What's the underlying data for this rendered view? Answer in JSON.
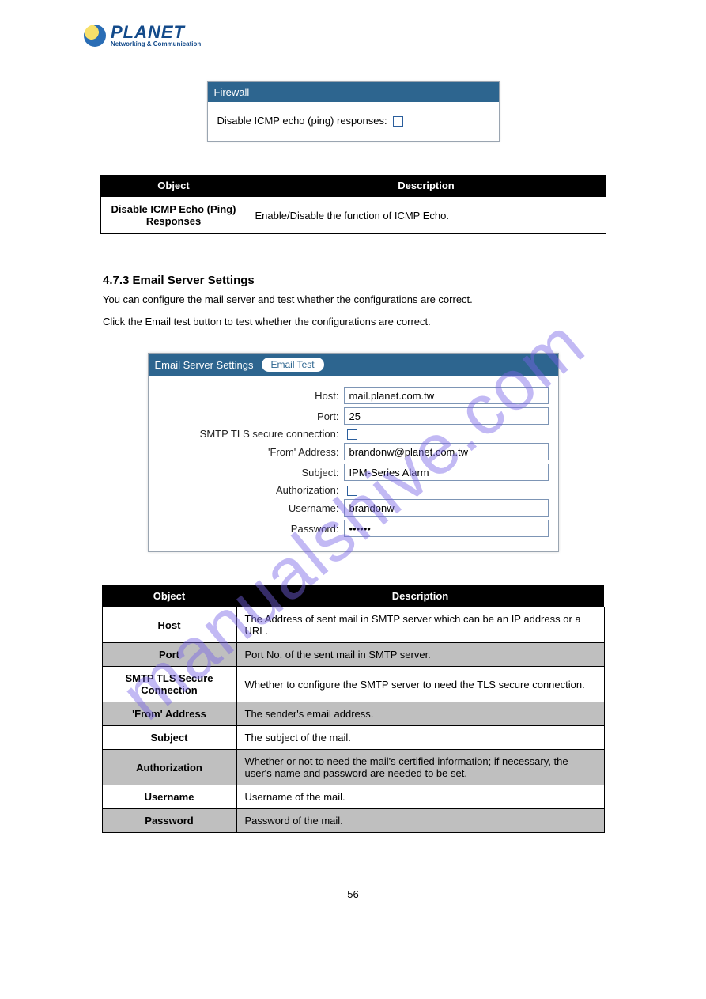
{
  "logo": {
    "brand": "PLANET",
    "tagline": "Networking & Communication"
  },
  "firewall_panel": {
    "title": "Firewall",
    "option_label": "Disable ICMP echo (ping) responses:"
  },
  "firewall_table": {
    "col_object": "Object",
    "col_desc": "Description",
    "row_object": "Disable ICMP Echo (Ping) Responses",
    "row_desc": "Enable/Disable the function of ICMP Echo."
  },
  "section": {
    "number_title": "4.7.3 Email Server Settings",
    "intro": "You can configure the mail server and test whether the configurations are correct.",
    "test_text": "Click the Email test button to test whether the configurations are correct."
  },
  "email_panel": {
    "title": "Email Server Settings",
    "test_button": "Email Test",
    "labels": {
      "host": "Host:",
      "port": "Port:",
      "tls": "SMTP TLS secure connection:",
      "from": "'From' Address:",
      "subject": "Subject:",
      "auth": "Authorization:",
      "user": "Username:",
      "pass": "Password:"
    },
    "values": {
      "host": "mail.planet.com.tw",
      "port": "25",
      "from": "brandonw@planet.com.tw",
      "subject": "IPM-Series Alarm",
      "user": "brandonw",
      "pass": "••••••"
    }
  },
  "email_table": {
    "col_object": "Object",
    "col_desc": "Description",
    "rows": [
      {
        "obj": "Host",
        "desc": "The Address of sent mail in SMTP server which can be an IP address or a URL."
      },
      {
        "obj": "Port",
        "desc": "Port No. of the sent mail in SMTP server."
      },
      {
        "obj": "SMTP TLS Secure Connection",
        "desc": "Whether to configure the SMTP server to need the TLS secure connection."
      },
      {
        "obj": "'From' Address",
        "desc": "The sender's email address."
      },
      {
        "obj": "Subject",
        "desc": "The subject of the mail."
      },
      {
        "obj": "Authorization",
        "desc": "Whether or not to need the mail's certified information; if necessary, the user's name and password are needed to be set."
      },
      {
        "obj": "Username",
        "desc": "Username of the mail."
      },
      {
        "obj": "Password",
        "desc": "Password of the mail."
      }
    ]
  },
  "watermark": "manualshive.com",
  "page_number": "56"
}
